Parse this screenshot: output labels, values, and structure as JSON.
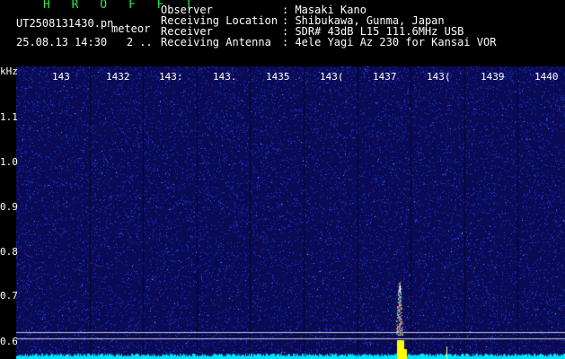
{
  "header": {
    "brand": "H R O F F T",
    "file_name": "UT2508131430.pn",
    "file_type": "meteor",
    "time_line": "25.08.13 14:30   2 .."
  },
  "station": {
    "labels": [
      "Observer",
      "Receiving Location",
      "Receiver",
      "Receiving Antenna"
    ],
    "values": [
      ": Masaki Kano",
      ": Shibukawa, Gunma, Japan",
      ": SDR# 43dB L15 111.6MHz USB",
      ": 4ele Yagi Az 230 for Kansai VOR"
    ]
  },
  "spectrogram": {
    "freq_unit": "kHz",
    "freq_ticks": [
      "1.1",
      "1.0",
      "0.9",
      "0.8",
      "0.7",
      "0.6"
    ],
    "time_ticks": [
      "143",
      "1432",
      "143:",
      "143.",
      "1435",
      "143(",
      "1437",
      "143(",
      "1439",
      "1440"
    ],
    "colors": {
      "background": "#0a0a55",
      "noise": "#1d3bd6",
      "baseline": "#00e5ff",
      "guide_lines": "#c8c8c8",
      "echo_core": "#ffff00"
    }
  }
}
